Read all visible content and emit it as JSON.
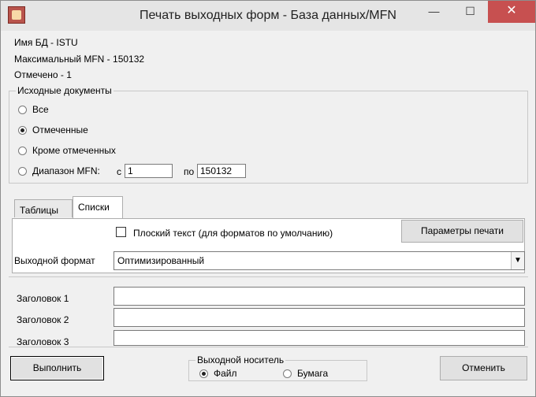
{
  "window": {
    "title": "Печать выходных форм - База данных/MFN",
    "min_glyph": "—",
    "max_glyph": "☐",
    "close_glyph": "✕"
  },
  "info": {
    "db_name": "Имя БД - ISTU",
    "max_mfn": "Максимальный MFN  - 150132",
    "marked": "Отмечено - 1"
  },
  "source_docs": {
    "caption": "Исходные документы",
    "options": [
      {
        "label": "Все",
        "selected": false
      },
      {
        "label": "Отмеченные",
        "selected": true
      },
      {
        "label": "Кроме отмеченных",
        "selected": false
      },
      {
        "label": "Диапазон MFN:",
        "selected": false
      }
    ],
    "from_label": "с",
    "from_value": "1",
    "to_label": "по",
    "to_value": "150132"
  },
  "tabs": [
    {
      "label": "Таблицы",
      "active": false
    },
    {
      "label": "Списки",
      "active": true
    }
  ],
  "lists_panel": {
    "plain_text_label": "Плоский текст (для форматов по умолчанию)",
    "plain_text_checked": false,
    "print_params_button": "Параметры печати",
    "output_format_label": "Выходной формат",
    "output_format_value": "Оптимизированный"
  },
  "headers": [
    {
      "label": "Заголовок 1",
      "value": ""
    },
    {
      "label": "Заголовок 2",
      "value": ""
    },
    {
      "label": "Заголовок 3",
      "value": ""
    }
  ],
  "footer": {
    "execute_button": "Выполнить",
    "cancel_button": "Отменить",
    "output_media_caption": "Выходной носитель",
    "media_options": [
      {
        "label": "Файл",
        "selected": true
      },
      {
        "label": "Бумага",
        "selected": false
      }
    ]
  }
}
